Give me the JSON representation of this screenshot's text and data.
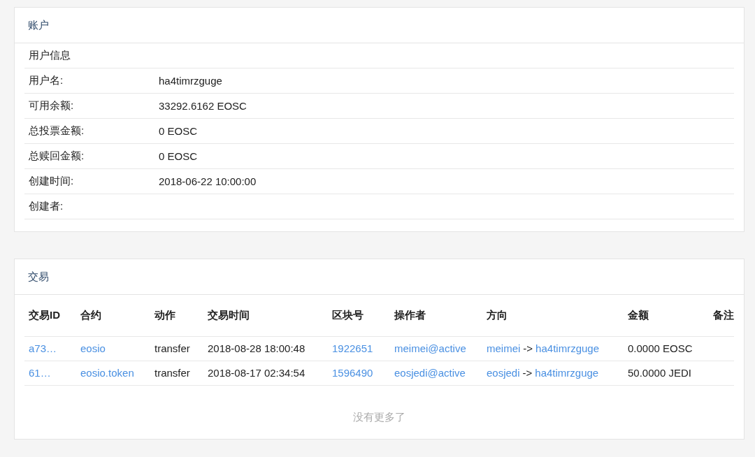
{
  "account": {
    "title": "账户",
    "section": "用户信息",
    "fields": [
      {
        "label": "用户名:",
        "value": "ha4timrzguge"
      },
      {
        "label": "可用余额:",
        "value": "33292.6162 EOSC"
      },
      {
        "label": "总投票金额:",
        "value": "0 EOSC"
      },
      {
        "label": "总赎回金额:",
        "value": "0 EOSC"
      },
      {
        "label": "创建时间:",
        "value": "2018-06-22 10:00:00"
      },
      {
        "label": "创建者:"
      }
    ]
  },
  "transactions": {
    "title": "交易",
    "columns": [
      "交易ID",
      "合约",
      "动作",
      "交易时间",
      "区块号",
      "操作者",
      "方向",
      "金额",
      "备注"
    ],
    "rows": [
      {
        "id": "a73…",
        "contract": "eosio",
        "action": "transfer",
        "time": "2018-08-28 18:00:48",
        "block": "1922651",
        "actor": "meimei@active",
        "from": "meimei",
        "arrow": "->",
        "to": "ha4timrzguge",
        "amount": "0.0000 EOSC"
      },
      {
        "id": "61…",
        "contract": "eosio.token",
        "action": "transfer",
        "time": "2018-08-17 02:34:54",
        "block": "1596490",
        "actor": "eosjedi@active",
        "from": "eosjedi",
        "arrow": "->",
        "to": "ha4timrzguge",
        "amount": "50.0000 JEDI"
      }
    ],
    "footer": "没有更多了"
  }
}
